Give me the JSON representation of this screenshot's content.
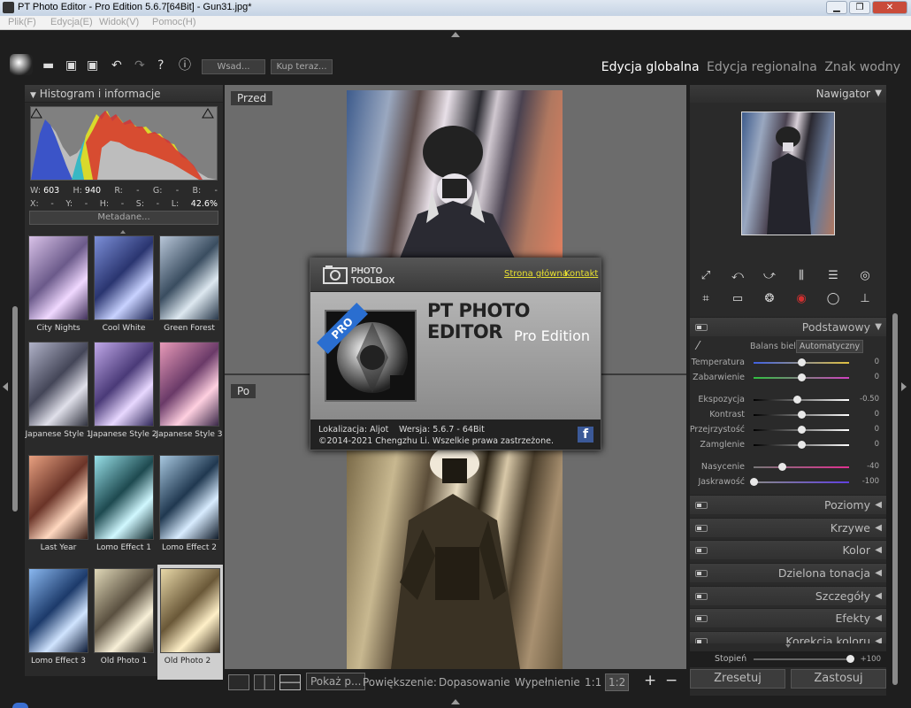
{
  "window": {
    "title": "PT Photo Editor - Pro Edition 5.6.7[64Bit] - Gun31.jpg*"
  },
  "menu": [
    "Plik(F)",
    "Edycja(E)",
    "Widok(V)",
    "Pomoc(H)"
  ],
  "toolbar": {
    "batch_label": "Wsad...",
    "buy_label": "Kup teraz..."
  },
  "modes": {
    "global": "Edycja globalna",
    "regional": "Edycja regionalna",
    "watermark": "Znak wodny"
  },
  "left_panel": {
    "histogram_title": "Histogram i informacje",
    "info": {
      "w_label": "W:",
      "w": "603",
      "h_label": "H:",
      "h": "940",
      "r_label": "R:",
      "r": "-",
      "g_label": "G:",
      "g": "-",
      "b_label": "B:",
      "b": "-",
      "x_label": "X:",
      "x": "-",
      "y_label": "Y:",
      "y": "-",
      "hh_label": "H:",
      "hh": "-",
      "s_label": "S:",
      "s": "-",
      "l_label": "L:",
      "l": "42.6%"
    },
    "metadata_label": "Metadane...",
    "presets": [
      "City Nights",
      "Cool White",
      "Green Forest",
      "Japanese Style 1",
      "Japanese Style 2",
      "Japanese Style 3",
      "Last Year",
      "Lomo Effect 1",
      "Lomo Effect 2",
      "Lomo Effect 3",
      "Old Photo 1",
      "Old Photo 2"
    ],
    "selected_preset": "Old Photo 2"
  },
  "center": {
    "before_label": "Przed",
    "after_label": "Po"
  },
  "bottom": {
    "show_label": "Pokaż p...",
    "zoom_label": "Powiększenie:",
    "fit_label": "Dopasowanie",
    "fill_label": "Wypełnienie",
    "one_to_one": "1:1",
    "one_to_two": "1:2",
    "zoom_in": "+",
    "zoom_out": "−"
  },
  "about": {
    "brand_line1": "PHOTO",
    "brand_line2": "TOOLBOX",
    "home_link": "Strona główna",
    "contact_link": "Kontakt",
    "pro_badge": "PRO",
    "title": "PT PHOTO EDITOR",
    "subtitle": "Pro Edition",
    "localization": "Lokalizacja: Aljot",
    "version": "Wersja: 5.6.7 - 64Bit",
    "copyright": "©2014-2021 Chengzhu Li. Wszelkie prawa zastrzeżone.",
    "facebook": "f"
  },
  "right_panel": {
    "navigator_title": "Nawigator",
    "basic_title": "Podstawowy",
    "white_balance_label": "Balans bieli",
    "white_balance_value": "Automatyczny",
    "sliders": [
      {
        "label": "Temperatura",
        "value": "0",
        "pos": 0.5
      },
      {
        "label": "Zabarwienie",
        "value": "0",
        "pos": 0.5
      },
      {
        "label": "Ekspozycja",
        "value": "-0.50",
        "pos": 0.45
      },
      {
        "label": "Kontrast",
        "value": "0",
        "pos": 0.5
      },
      {
        "label": "Przejrzystość",
        "value": "0",
        "pos": 0.5
      },
      {
        "label": "Zamglenie",
        "value": "0",
        "pos": 0.5
      },
      {
        "label": "Nasycenie",
        "value": "-40",
        "pos": 0.3
      },
      {
        "label": "Jaskrawość",
        "value": "-100",
        "pos": 0.0
      }
    ],
    "sections": [
      "Poziomy",
      "Krzywe",
      "Kolor",
      "Dzielona tonacja",
      "Szczegóły",
      "Efekty",
      "Korekcja koloru"
    ],
    "degree_label": "Stopień",
    "degree_value": "+100",
    "reset_label": "Zresetuj",
    "apply_label": "Zastosuj"
  }
}
